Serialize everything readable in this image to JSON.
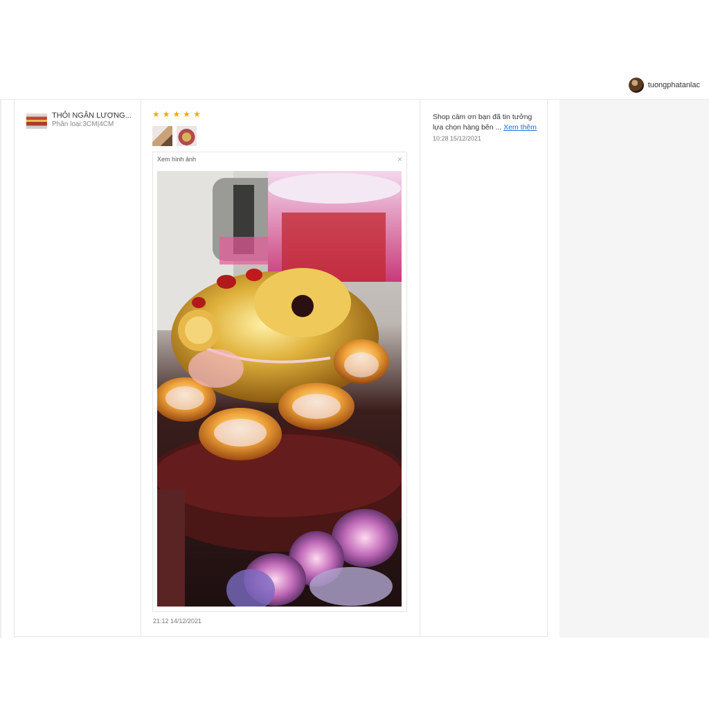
{
  "header": {
    "username": "tuongphatanlac"
  },
  "product": {
    "title": "THỎI NGÂN LƯỢNG...",
    "variant": "Phân loại:3CM|4CM"
  },
  "review": {
    "rating": 5,
    "stars": [
      "★",
      "★",
      "★",
      "★",
      "★"
    ],
    "viewer_title": "Xem hình ảnh",
    "close_glyph": "×",
    "timestamp": "21:12 14/12/2021"
  },
  "reply": {
    "text": "Shop cảm ơn bạn đã tin tưởng lựa chọn hàng bên ...",
    "see_more": "Xem thêm",
    "timestamp": "10:28 15/12/2021"
  },
  "colors": {
    "star": "#f6a700",
    "link": "#1a6fe0",
    "border": "#e5e5e5",
    "panel": "#f5f5f5"
  }
}
